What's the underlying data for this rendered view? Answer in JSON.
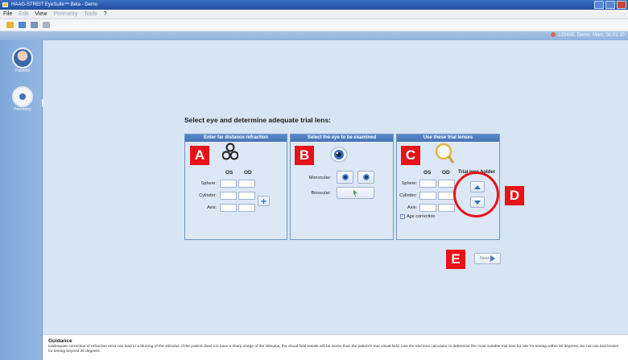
{
  "window": {
    "title": "HAAG-STREIT EyeSuite™ Beta - Demo"
  },
  "menu": [
    {
      "label": "File",
      "enabled": true
    },
    {
      "label": "Edit",
      "enabled": false
    },
    {
      "label": "View",
      "enabled": true
    },
    {
      "label": "Perimetry",
      "enabled": false
    },
    {
      "label": "Tools",
      "enabled": false
    },
    {
      "label": "?",
      "enabled": true
    }
  ],
  "patient_info": "123455, Demo, Marc, 01.01.10",
  "sidebar": {
    "items": [
      {
        "label": "Patients",
        "icon": "patient-avatar-icon"
      },
      {
        "label": "Perimetry",
        "icon": "perimetry-icon"
      }
    ]
  },
  "heading": "Select eye and determine adequate trial lens:",
  "panel_a": {
    "title": "Enter far distance refraction",
    "marker": "A",
    "col_os": "OS",
    "col_od": "OD",
    "rows": [
      "Sphere:",
      "Cylinder:",
      "Axis:"
    ]
  },
  "panel_b": {
    "title": "Select the eye to be examined",
    "marker": "B",
    "monocular_label": "Monocular:",
    "binocular_label": "Binocular:",
    "btn_os": "OS",
    "btn_od": "OD"
  },
  "panel_c": {
    "title": "Use these trial lenses",
    "marker": "C",
    "col_os": "OS",
    "col_od": "OD",
    "col_holder": "Trial lens holder",
    "rows": [
      "Sphere:",
      "Cylinder:",
      "Axis:"
    ],
    "age_correction": "Age correction"
  },
  "marker_d": "D",
  "marker_e": "E",
  "next_label": "Next",
  "guidance": {
    "title": "Guidance",
    "text": "Inadequate correction of refractive error can lead to a blurring of the stimulus. If the patient does not have a sharp image of the stimulus, the visual field results will be worse than the patient's true visual field. Use the trial lens calculator to determine the most suitable trial lens for use for testing within 30 degrees. Do not use trial lenses for testing beyond 30 degrees."
  },
  "colors": {
    "accent": "#2f6fc0",
    "marker": "#e8111a",
    "panel_header": "#4f80c2"
  }
}
